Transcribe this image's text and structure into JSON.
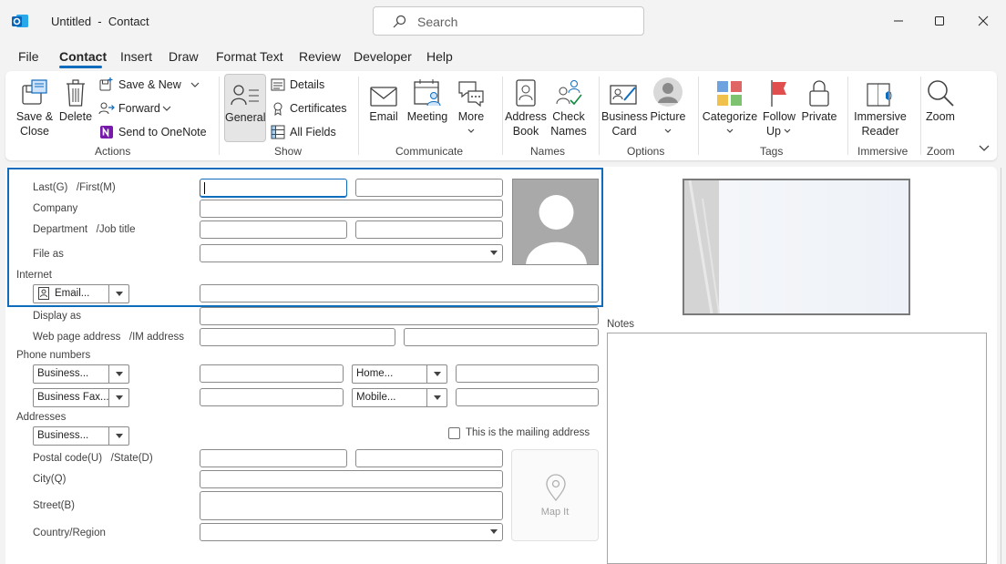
{
  "window": {
    "title": "Untitled  -  Contact"
  },
  "search": {
    "placeholder": "Search"
  },
  "menu": {
    "tabs": [
      "File",
      "Contact",
      "Insert",
      "Draw",
      "Format Text",
      "Review",
      "Developer",
      "Help"
    ],
    "active": "Contact"
  },
  "ribbon": {
    "actions": {
      "save_close": [
        "Save &",
        "Close"
      ],
      "delete": "Delete",
      "save_new": "Save & New",
      "forward": "Forward",
      "onenote": "Send to OneNote",
      "label": "Actions"
    },
    "show": {
      "general": "General",
      "details": "Details",
      "certificates": "Certificates",
      "all_fields": "All Fields",
      "label": "Show"
    },
    "communicate": {
      "email": "Email",
      "meeting": "Meeting",
      "more": "More",
      "label": "Communicate"
    },
    "names": {
      "address_book": [
        "Address",
        "Book"
      ],
      "check_names": [
        "Check",
        "Names"
      ],
      "label": "Names"
    },
    "options": {
      "business_card": [
        "Business",
        "Card"
      ],
      "picture": "Picture",
      "label": "Options"
    },
    "tags": {
      "categorize": "Categorize",
      "follow_up": [
        "Follow",
        "Up"
      ],
      "private": "Private",
      "label": "Tags"
    },
    "immersive": {
      "reader": [
        "Immersive",
        "Reader"
      ],
      "label": "Immersive"
    },
    "zoom": {
      "zoom": "Zoom",
      "label": "Zoom"
    }
  },
  "form": {
    "last_first": "Last(G)   /First(M)",
    "company": "Company",
    "dept_job": "Department   /Job title",
    "file_as": "File as",
    "internet": "Internet",
    "email_btn": "Email...",
    "display_as": "Display as",
    "web_im": "Web page address   /IM address",
    "phone_numbers": "Phone numbers",
    "business_phone": "Business...",
    "business_fax": "Business Fax...",
    "home_phone": "Home...",
    "mobile_phone": "Mobile...",
    "addresses": "Addresses",
    "address_type": "Business...",
    "mailing_address": "This is the mailing address",
    "postal_state": "Postal code(U)   /State(D)",
    "city": "City(Q)",
    "street": "Street(B)",
    "country": "Country/Region",
    "map_it": "Map It",
    "notes": "Notes"
  },
  "colors": {
    "accent": "#0f6cbd"
  }
}
